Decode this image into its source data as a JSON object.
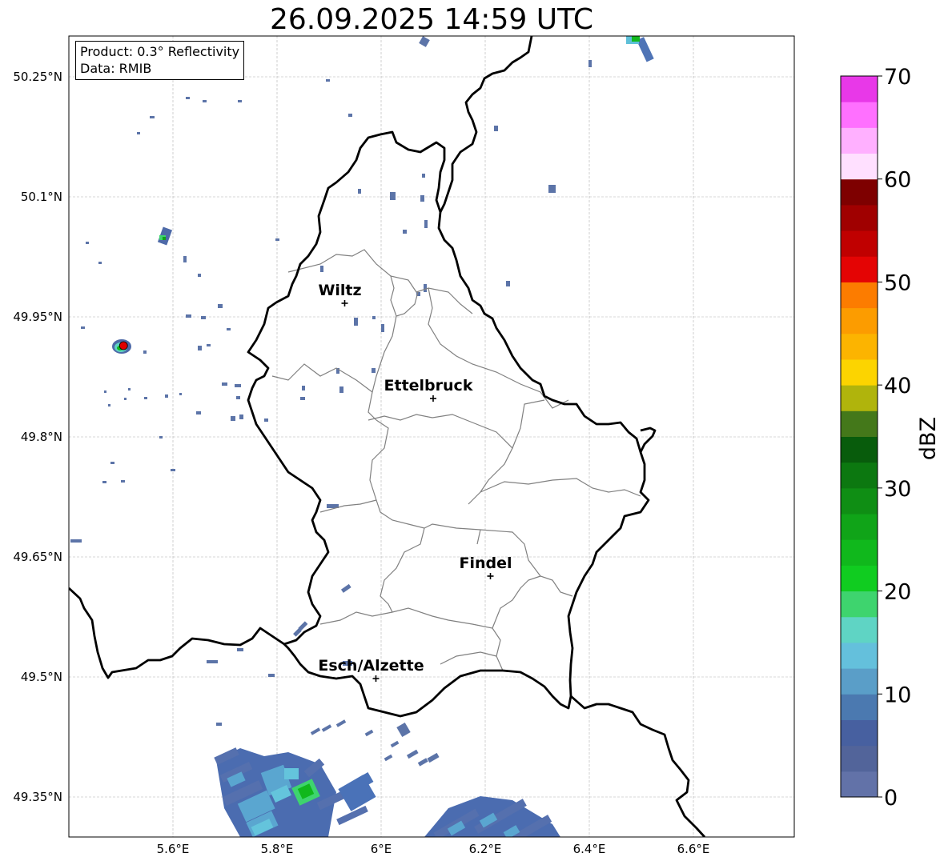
{
  "title": "26.09.2025 14:59 UTC",
  "info": {
    "product": "Product: 0.3° Reflectivity",
    "data": "Data: RMIB"
  },
  "map": {
    "lon_range": [
      5.4,
      6.8
    ],
    "lat_range": [
      49.3,
      50.3
    ],
    "x_ticks": [
      {
        "lon": 5.6,
        "label": "5.6°E"
      },
      {
        "lon": 5.8,
        "label": "5.8°E"
      },
      {
        "lon": 6.0,
        "label": "6°E"
      },
      {
        "lon": 6.2,
        "label": "6.2°E"
      },
      {
        "lon": 6.4,
        "label": "6.4°E"
      },
      {
        "lon": 6.6,
        "label": "6.6°E"
      }
    ],
    "y_ticks": [
      {
        "lat": 50.25,
        "label": "50.25°N"
      },
      {
        "lat": 50.1,
        "label": "50.1°N"
      },
      {
        "lat": 49.95,
        "label": "49.95°N"
      },
      {
        "lat": 49.8,
        "label": "49.8°N"
      },
      {
        "lat": 49.65,
        "label": "49.65°N"
      },
      {
        "lat": 49.5,
        "label": "49.5°N"
      },
      {
        "lat": 49.35,
        "label": "49.35°N"
      }
    ],
    "gridlines": true,
    "cities": [
      {
        "name": "Wiltz",
        "lon": 5.93,
        "lat": 49.967
      },
      {
        "name": "Ettelbruck",
        "lon": 6.1,
        "lat": 49.848
      },
      {
        "name": "Findel",
        "lon": 6.21,
        "lat": 49.626
      },
      {
        "name": "Esch/Alzette",
        "lon": 5.99,
        "lat": 49.498
      }
    ],
    "radar_site": {
      "lon": 5.505,
      "lat": 49.914,
      "color": "#e00000"
    },
    "country_border_color": "#000000",
    "canton_border_color": "#808080"
  },
  "colorbar": {
    "label": "dBZ",
    "min": 0,
    "max": 70,
    "ticks": [
      "0",
      "10",
      "20",
      "30",
      "40",
      "50",
      "60",
      "70"
    ],
    "colors": [
      "#6272a8",
      "#52649a",
      "#4760a0",
      "#4b79b0",
      "#5a9ec8",
      "#64c0dc",
      "#5fd4c4",
      "#3ed46e",
      "#10cc20",
      "#10b81c",
      "#10a418",
      "#0f8e14",
      "#0c7810",
      "#085c0c",
      "#44781a",
      "#b0b40c",
      "#fcd400",
      "#fcb400",
      "#fc9c00",
      "#fc7c00",
      "#e40404",
      "#c00000",
      "#a00000",
      "#7e0000",
      "#ffe0ff",
      "#ffb0ff",
      "#ff70ff",
      "#e838e8"
    ]
  }
}
